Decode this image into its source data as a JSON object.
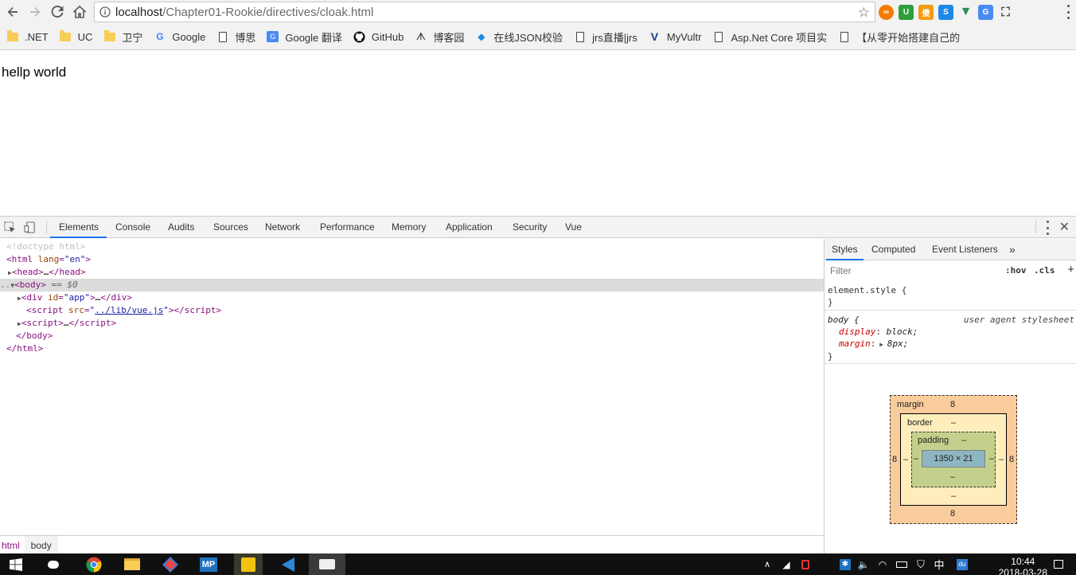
{
  "browser": {
    "url_host": "localhost",
    "url_path": "/Chapter01-Rookie/directives/cloak.html",
    "bookmarks": [
      {
        "label": ".NET",
        "icon": "folder-icon"
      },
      {
        "label": "UC",
        "icon": "folder-icon"
      },
      {
        "label": "卫宁",
        "icon": "folder-icon"
      },
      {
        "label": "Google",
        "icon": "google-icon"
      },
      {
        "label": "博思",
        "icon": "page-icon"
      },
      {
        "label": "Google 翻译",
        "icon": "translate-icon"
      },
      {
        "label": "GitHub",
        "icon": "github-icon"
      },
      {
        "label": "博客园",
        "icon": "cnblogs-icon"
      },
      {
        "label": "在线JSON校验",
        "icon": "json-icon"
      },
      {
        "label": "jrs直播|jrs",
        "icon": "page-icon"
      },
      {
        "label": "MyVultr",
        "icon": "vultr-icon"
      },
      {
        "label": "Asp.Net Core 项目实",
        "icon": "page-icon"
      },
      {
        "label": "【从零开始搭建自己的",
        "icon": "page-icon"
      }
    ]
  },
  "page": {
    "text": "hellp world"
  },
  "devtools": {
    "tabs": [
      "Elements",
      "Console",
      "Audits",
      "Sources",
      "Network",
      "Performance",
      "Memory",
      "Application",
      "Security",
      "Vue"
    ],
    "active_tab": "Elements",
    "dom": {
      "doctype": "<!doctype html>",
      "html_open_tag": "html",
      "html_attr": "lang",
      "html_attr_val": "\"en\"",
      "head": "head",
      "head_ellipsis": "…",
      "body": "body",
      "selected_marker": "== $0",
      "div_tag": "div",
      "div_attr": "id",
      "div_attr_val": "\"app\"",
      "script_tag": "script",
      "script_attr": "src",
      "script_src": "../lib/vue.js",
      "ellipsis": "…"
    },
    "breadcrumbs": [
      "html",
      "body"
    ],
    "sidebar": {
      "tabs": [
        "Styles",
        "Computed",
        "Event Listeners"
      ],
      "more": "»",
      "filter_placeholder": "Filter",
      "hov": ":hov",
      "cls": ".cls",
      "plus": "+",
      "element_style_selector": "element.style {",
      "close_brace": "}",
      "body_selector": "body {",
      "ua_label": "user agent stylesheet",
      "props": [
        {
          "name": "display",
          "value": "block;"
        },
        {
          "name": "margin",
          "value": "8px;"
        }
      ]
    },
    "box_model": {
      "margin_label": "margin",
      "border_label": "border",
      "padding_label": "padding",
      "margin_top": "8",
      "margin_bottom": "8",
      "margin_left": "8",
      "margin_right": "8",
      "border_top": "–",
      "border_bottom": "–",
      "border_left": "–",
      "border_right": "–",
      "padding_top": "–",
      "padding_bottom": "–",
      "padding_left": "–",
      "padding_right": "–",
      "content": "1350 × 21"
    }
  },
  "taskbar": {
    "time": "10:44",
    "date": "2018-03-28",
    "ime": "中"
  }
}
